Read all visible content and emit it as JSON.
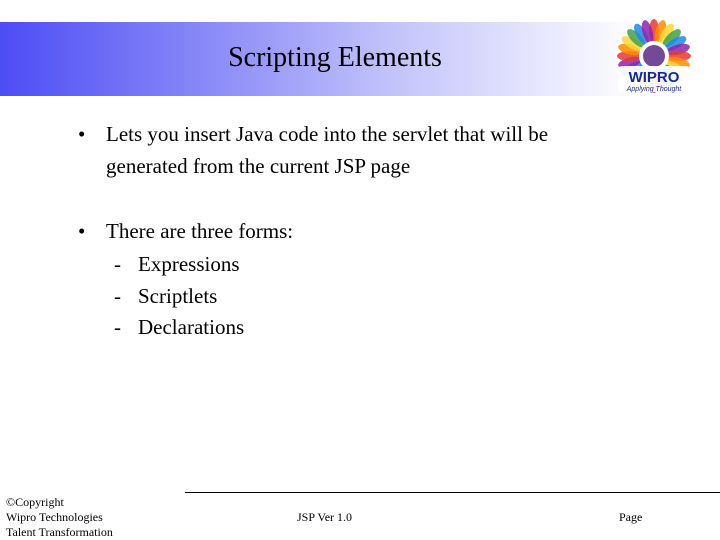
{
  "slide": {
    "title": "Scripting Elements",
    "bullets": [
      {
        "marker": "•",
        "lines": [
          "Lets you insert Java code into the servlet that will be",
          "generated from the current JSP page"
        ]
      },
      {
        "marker": "•",
        "text": "There are three forms:",
        "sub_items": [
          {
            "marker": "-",
            "text": "Expressions"
          },
          {
            "marker": "-",
            "text": "Scriptlets"
          },
          {
            "marker": "-",
            "text": "Declarations"
          }
        ]
      }
    ]
  },
  "logo": {
    "name": "WIPRO",
    "tagline": "Applying Thought",
    "colors": {
      "text": "#1a2a8a",
      "petals": [
        "#e53935",
        "#fb8c00",
        "#fdd835",
        "#43a047",
        "#1e88e5",
        "#8e24aa"
      ]
    }
  },
  "footer": {
    "left_lines": [
      "©Copyright",
      "Wipro Technologies",
      "Talent Transformation"
    ],
    "center": "JSP Ver 1.0",
    "right": "Page"
  },
  "colors": {
    "header_band_start": "#4d4df5",
    "header_band_end": "#ffffff"
  }
}
